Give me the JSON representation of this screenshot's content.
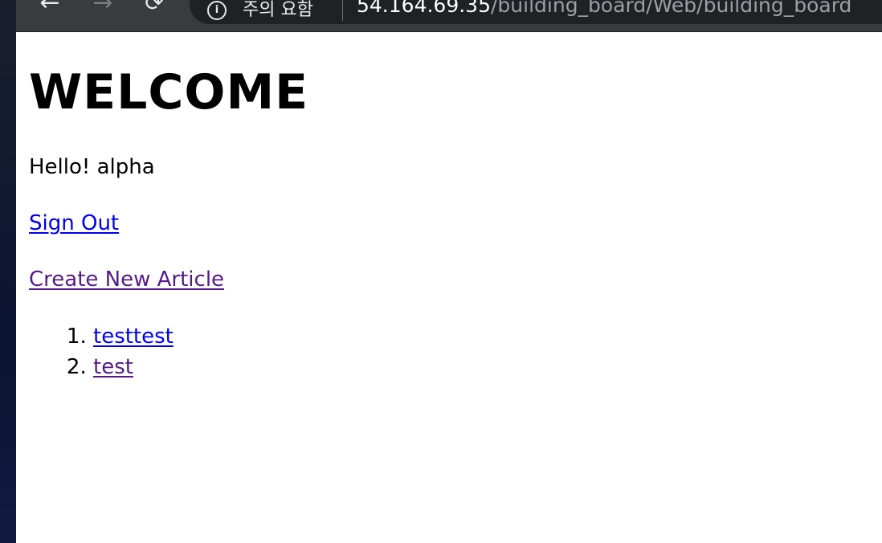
{
  "browser": {
    "back_icon": "←",
    "forward_icon": "→",
    "reload_icon": "⟳",
    "info_icon": "i",
    "security_label": "주의 요함",
    "url_host": "54.164.69.35",
    "url_path": "/building_board/Web/building_board"
  },
  "page": {
    "heading": "WELCOME",
    "greeting": "Hello! alpha",
    "sign_out": "Sign Out",
    "create_article": "Create New Article",
    "articles": [
      {
        "title": "testtest"
      },
      {
        "title": "test"
      }
    ]
  },
  "colors": {
    "link": "#0000ee",
    "visited_link": "#551a8b",
    "toolbar": "#3a3b3e",
    "omnibox": "#202124"
  }
}
